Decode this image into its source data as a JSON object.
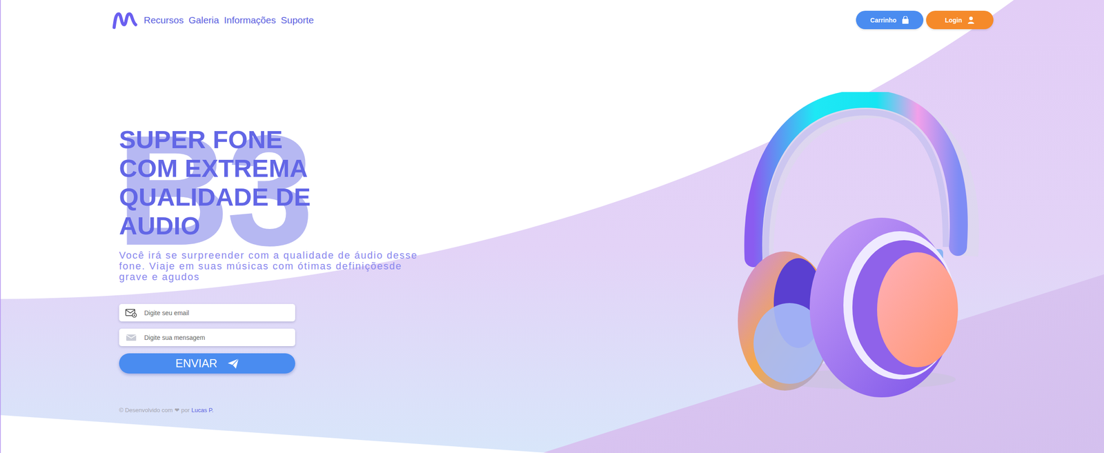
{
  "nav": {
    "links": [
      "Recursos",
      "Galeria",
      "Informações",
      "Suporte"
    ]
  },
  "buttons": [
    {
      "label": "Carrinho",
      "kind": "cart"
    },
    {
      "label": "Login",
      "kind": "login"
    }
  ],
  "hero": {
    "watermark": "B3",
    "title": "SUPER FONE COM EXTREMA QUALIDADE DE AUDIO",
    "subtitle": "Você irá se surpreender com a qualidade de áudio desse fone. Viaje em suas músicas com ótimas definiçõesde grave e agudos"
  },
  "form": {
    "email_placeholder": "Digite seu email",
    "message_placeholder": "Digite sua mensagem",
    "submit": "ENVIAR"
  },
  "footer": {
    "prefix": "© Desenvolvido com",
    "heart": "❤",
    "by": "por",
    "author": "Lucas P."
  }
}
